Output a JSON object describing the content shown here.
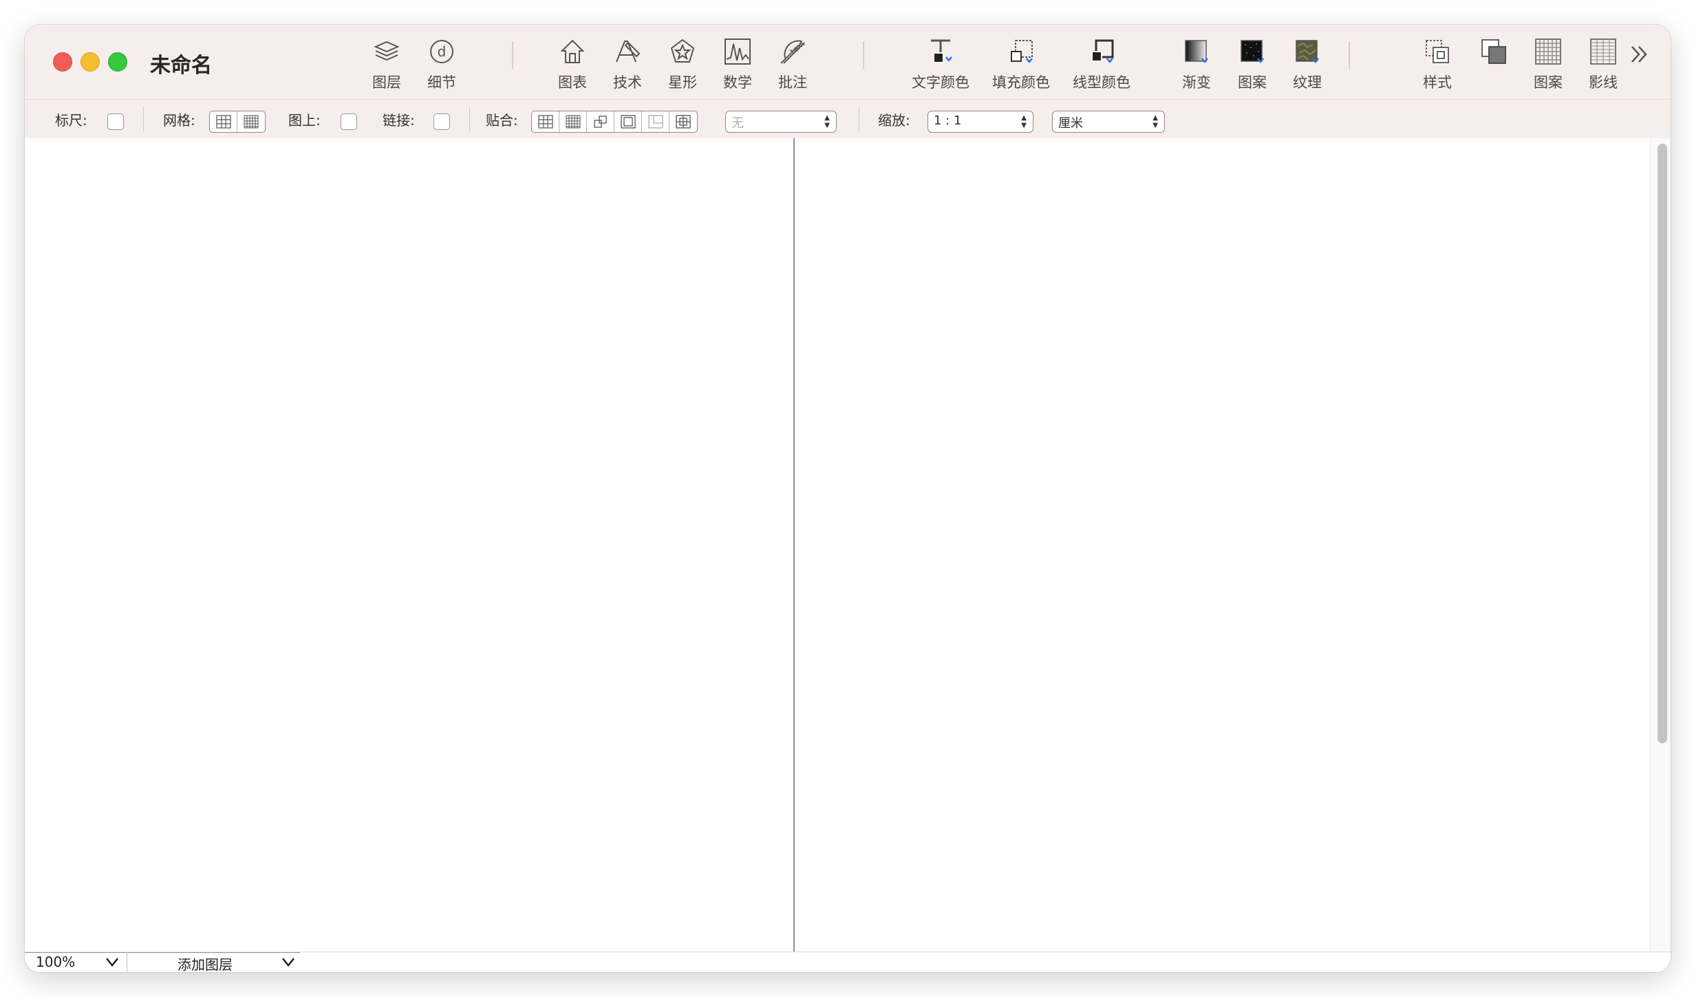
{
  "window": {
    "title": "未命名"
  },
  "toolbar": {
    "groups": [
      {
        "items": [
          {
            "label": "图层",
            "icon": "layers-icon"
          },
          {
            "label": "细节",
            "icon": "detail-icon"
          }
        ]
      },
      {
        "items": [
          {
            "label": "图表",
            "icon": "house-shape-icon"
          },
          {
            "label": "技术",
            "icon": "compass-ruler-icon"
          },
          {
            "label": "星形",
            "icon": "star-icon"
          },
          {
            "label": "数学",
            "icon": "waveform-icon"
          },
          {
            "label": "批注",
            "icon": "text-annotation-icon"
          }
        ]
      },
      {
        "items": [
          {
            "label": "文字颜色",
            "icon": "text-color-icon"
          },
          {
            "label": "填充颜色",
            "icon": "fill-color-icon"
          },
          {
            "label": "线型颜色",
            "icon": "stroke-color-icon"
          },
          {
            "label": "渐变",
            "icon": "gradient-icon"
          },
          {
            "label": "图案",
            "icon": "pattern-fill-icon"
          },
          {
            "label": "纹理",
            "icon": "texture-icon"
          }
        ]
      },
      {
        "items": [
          {
            "label": "样式",
            "icon": "style-icon"
          },
          {
            "label": "",
            "icon": "stack-icon"
          },
          {
            "label": "图案",
            "icon": "grid-pattern-icon"
          },
          {
            "label": "影线",
            "icon": "hatch-icon"
          }
        ]
      }
    ],
    "overflow_icon": "double-chevron-right-icon"
  },
  "options": {
    "ruler_label": "标尺:",
    "grid_label": "网格:",
    "on_top_label": "图上:",
    "link_label": "链接:",
    "snap_label": "贴合:",
    "snap_popup_value": "无",
    "scale_label": "缩放:",
    "scale_value": "1 : 1",
    "unit_value": "厘米"
  },
  "status": {
    "zoom": "100%",
    "add_layer": "添加图层"
  },
  "colors": {
    "titlebar_bg": "#f6eeec",
    "close": "#ee5d55",
    "minimize": "#f5be30",
    "maximize": "#37c73f",
    "accent_blue": "#2f6fe0"
  }
}
